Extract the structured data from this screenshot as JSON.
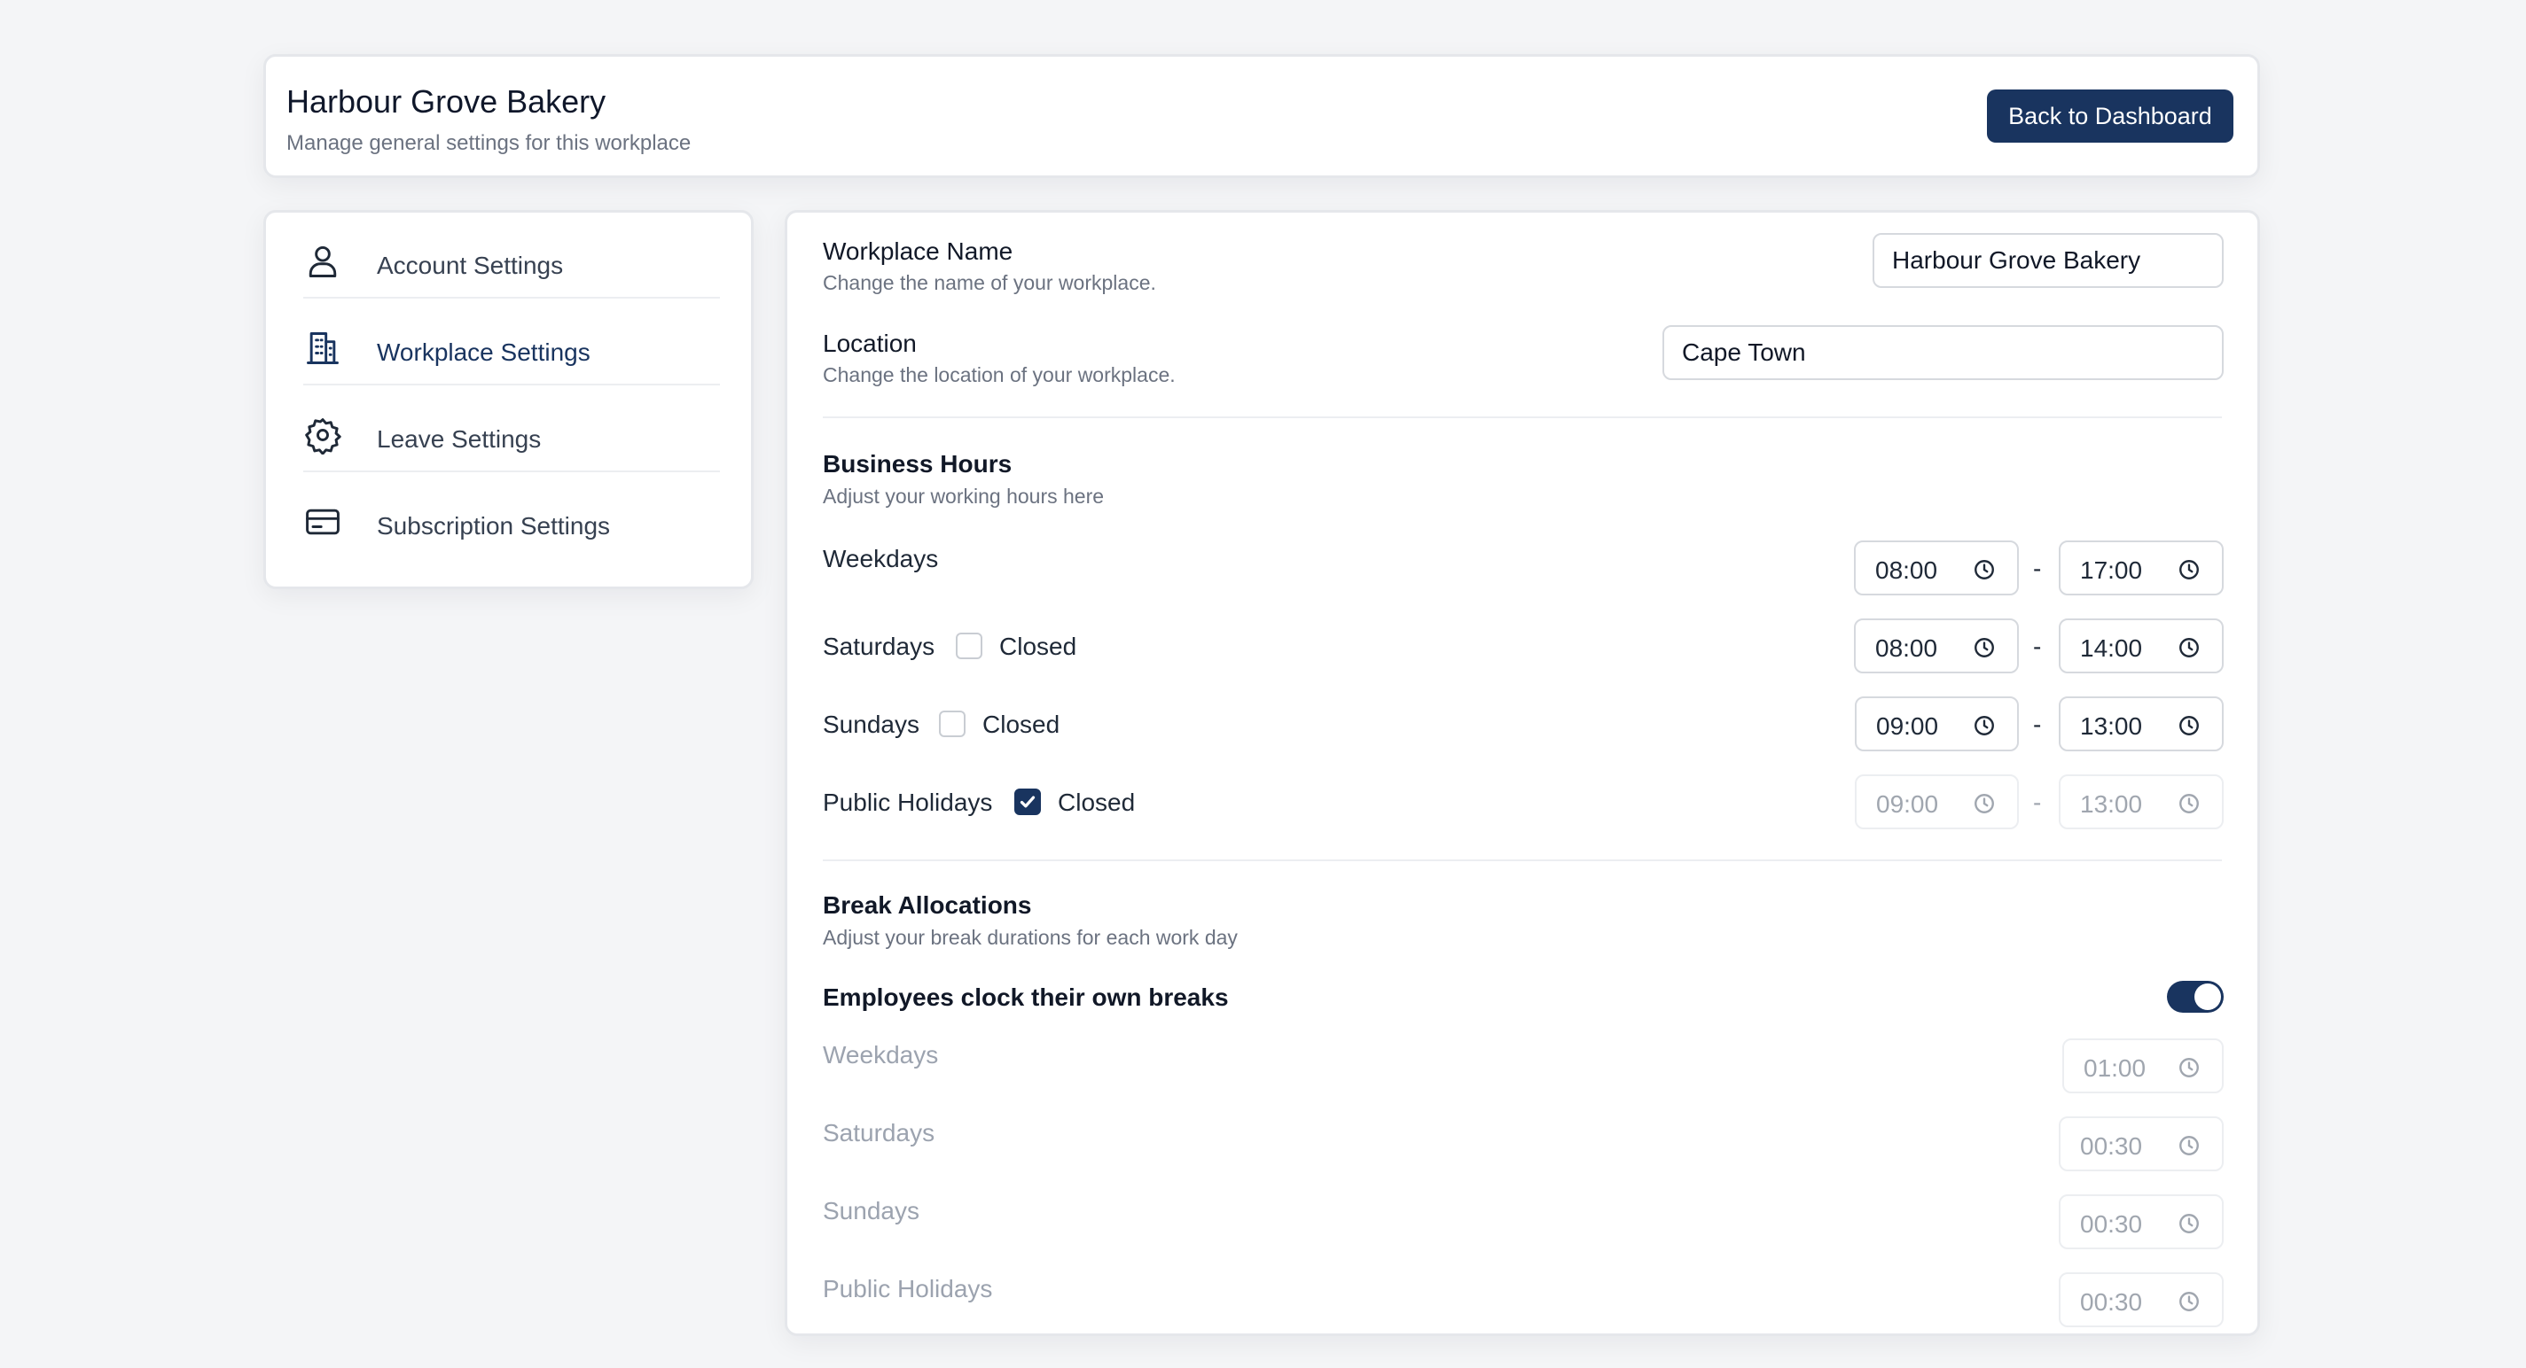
{
  "header": {
    "title": "Harbour Grove Bakery",
    "subtitle": "Manage general settings for this workplace",
    "back_button": "Back to Dashboard"
  },
  "sidebar": {
    "items": [
      {
        "label": "Account Settings",
        "icon": "user-icon",
        "active": false
      },
      {
        "label": "Workplace Settings",
        "icon": "building-icon",
        "active": true
      },
      {
        "label": "Leave Settings",
        "icon": "gear-icon",
        "active": false
      },
      {
        "label": "Subscription Settings",
        "icon": "credit-card-icon",
        "active": false
      }
    ]
  },
  "workplace": {
    "name_label": "Workplace Name",
    "name_desc": "Change the name of your workplace.",
    "name_value": "Harbour Grove Bakery",
    "location_label": "Location",
    "location_desc": "Change the location of your workplace.",
    "location_value": "Cape Town"
  },
  "business_hours": {
    "title": "Business Hours",
    "desc": "Adjust your working hours here",
    "separator": "-",
    "closed_label": "Closed",
    "rows": [
      {
        "label": "Weekdays",
        "start": "08:00",
        "end": "17:00",
        "has_closed": false,
        "closed": false
      },
      {
        "label": "Saturdays",
        "start": "08:00",
        "end": "14:00",
        "has_closed": true,
        "closed": false
      },
      {
        "label": "Sundays",
        "start": "09:00",
        "end": "13:00",
        "has_closed": true,
        "closed": false
      },
      {
        "label": "Public Holidays",
        "start": "09:00",
        "end": "13:00",
        "has_closed": true,
        "closed": true
      }
    ]
  },
  "breaks": {
    "title": "Break Allocations",
    "desc": "Adjust your break durations for each work day",
    "toggle_label": "Employees clock their own breaks",
    "toggle_on": true,
    "rows": [
      {
        "label": "Weekdays",
        "duration": "01:00"
      },
      {
        "label": "Saturdays",
        "duration": "00:30"
      },
      {
        "label": "Sundays",
        "duration": "00:30"
      },
      {
        "label": "Public Holidays",
        "duration": "00:30"
      }
    ]
  },
  "colors": {
    "accent": "#19345f",
    "background": "#f4f5f7",
    "muted_text": "#6b7280",
    "disabled_text": "#a0a6af"
  }
}
